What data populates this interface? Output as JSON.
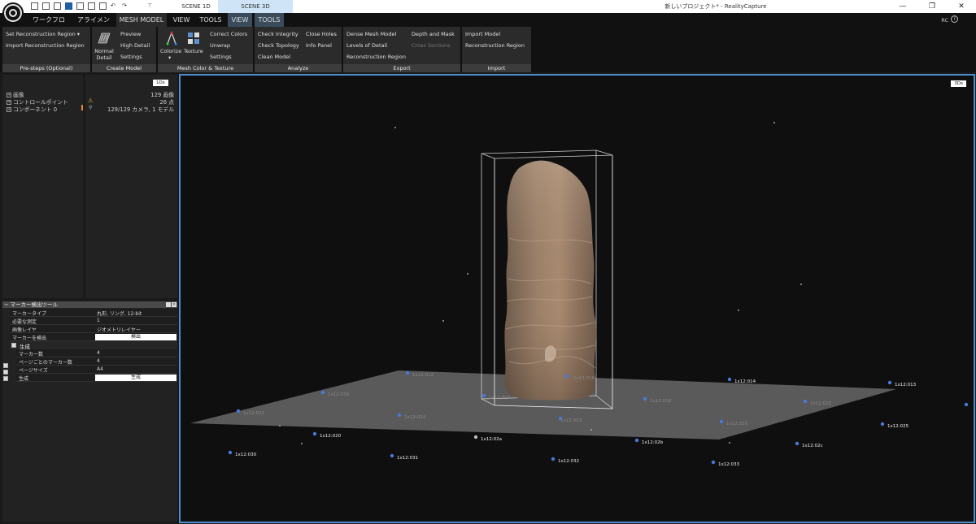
{
  "window": {
    "title": "新しいプロジェクト* - RealityCapture",
    "tabs": [
      {
        "label": "SCENE 1D",
        "active": false
      },
      {
        "label": "SCENE 3D",
        "active": true
      }
    ],
    "minimize": "—",
    "maximize": "❐",
    "close": "✕",
    "pin": "⊤"
  },
  "menu": {
    "items": [
      {
        "label": "ワークフロー"
      },
      {
        "label": "アライメント"
      },
      {
        "label": "MESH MODEL"
      },
      {
        "label": "VIEW"
      },
      {
        "label": "TOOLS"
      },
      {
        "label": "VIEW"
      },
      {
        "label": "TOOLS"
      }
    ],
    "right_text": "RC",
    "help": "?"
  },
  "ribbon": {
    "prestep": {
      "items": [
        "Set Reconstruction Region",
        "Import Reconstruction Region"
      ],
      "label": "Pre-steps (Optional)"
    },
    "create": {
      "big": "Normal Detail",
      "items": [
        "Preview",
        "High Detail",
        "Settings"
      ],
      "label": "Create Model"
    },
    "color": {
      "colorize": "Colorize",
      "texture": "Texture",
      "items": [
        "Correct Colors",
        "Unwrap",
        "Settings"
      ],
      "label": "Mesh Color & Texture"
    },
    "analyze": {
      "items": [
        "Check Integrity",
        "Check Topology",
        "Clean Model",
        "Close Holes",
        "Info Panel"
      ],
      "label": "Analyze"
    },
    "export": {
      "items": [
        "Dense Mesh Model",
        "Levels of Detail",
        "Reconstruction Region",
        "Depth and Mask",
        "Cross Sections"
      ],
      "label": "Export"
    },
    "import": {
      "items": [
        "Import Model",
        "Reconstruction Region"
      ],
      "label": "Import"
    }
  },
  "tree": {
    "badge": "1Ds",
    "rows": [
      {
        "name": "画像",
        "value": "129 画像"
      },
      {
        "name": "コントロールポイント",
        "value": "26 点"
      },
      {
        "name": "コンポーネント 0",
        "value": "129/129 カメラ, 1 モデル"
      }
    ]
  },
  "marker_tool": {
    "title": "マーカー検出ツール",
    "rows": [
      {
        "k": "マーカータイプ",
        "v": "丸形, リング, 12-bit"
      },
      {
        "k": "必要な測定",
        "v": "1"
      },
      {
        "k": "画像レイヤ",
        "v": "ジオメトリレイヤー"
      },
      {
        "k": "マーカーを検出",
        "btn": "検出"
      }
    ],
    "section": "生成",
    "rows2": [
      {
        "k": "マーカー数",
        "v": "4"
      },
      {
        "k": "ページごとのマーカー数",
        "v": "4"
      },
      {
        "k": "ページサイズ",
        "v": "A4"
      },
      {
        "k": "生成",
        "btn": "生成"
      }
    ]
  },
  "viewport": {
    "badge": "3Ds",
    "markers": [
      {
        "label": "1x12:012",
        "dim": true
      },
      {
        "label": "1x12:013",
        "dim": false
      },
      {
        "label": "1x12:014",
        "dim": false
      },
      {
        "label": "1x12:015",
        "dim": false
      },
      {
        "label": "1x12:016",
        "dim": true
      },
      {
        "label": "1x12:017",
        "dim": true
      },
      {
        "label": "1x12:018",
        "dim": true
      },
      {
        "label": "1x12:019",
        "dim": true
      },
      {
        "label": "1x12:020",
        "dim": false
      },
      {
        "label": "1x12:021",
        "dim": true
      },
      {
        "label": "1x12:023",
        "dim": true
      },
      {
        "label": "1x12:024",
        "dim": true
      },
      {
        "label": "1x12:025",
        "dim": false
      },
      {
        "label": "1x12:02a",
        "dim": false
      },
      {
        "label": "1x12:02b",
        "dim": false
      },
      {
        "label": "1x12:02c",
        "dim": false
      },
      {
        "label": "1x12:030",
        "dim": false
      },
      {
        "label": "1x12:031",
        "dim": false
      },
      {
        "label": "1x12:032",
        "dim": false
      },
      {
        "label": "1x12:033",
        "dim": false
      },
      {
        "label": "1x12:09?",
        "dim": false
      }
    ]
  }
}
